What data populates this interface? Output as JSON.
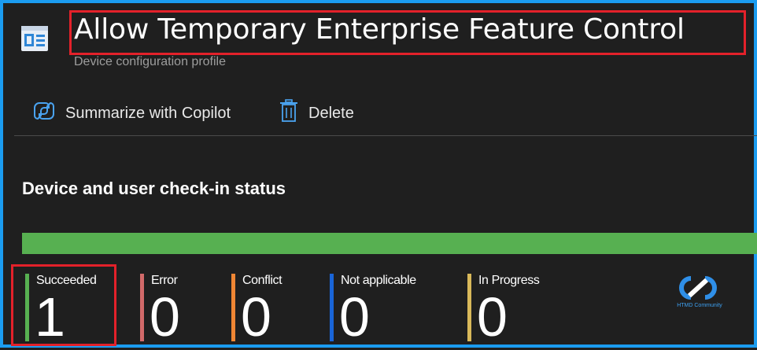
{
  "header": {
    "title": "Allow Temporary Enterprise Feature Control",
    "subtitle": "Device configuration profile",
    "icon": "profile-icon"
  },
  "toolbar": {
    "copilot_label": "Summarize with Copilot",
    "copilot_icon": "copilot-icon",
    "delete_label": "Delete",
    "delete_icon": "trash-icon"
  },
  "status_section": {
    "title": "Device and user check-in status",
    "progress_fraction": 1.0,
    "counters": [
      {
        "label": "Succeeded",
        "value": "1",
        "color": "#57b051"
      },
      {
        "label": "Error",
        "value": "0",
        "color": "#d16a6a"
      },
      {
        "label": "Conflict",
        "value": "0",
        "color": "#f08634"
      },
      {
        "label": "Not applicable",
        "value": "0",
        "color": "#1965d8"
      },
      {
        "label": "In Progress",
        "value": "0",
        "color": "#d9b95a"
      }
    ]
  },
  "watermark": {
    "text": "HTMD Community",
    "icon": "htmd-logo-icon"
  },
  "colors": {
    "background": "#1f1f1f",
    "border": "#1b9cf0",
    "highlight": "#e3212a",
    "accent_icon": "#4aa3f0"
  }
}
